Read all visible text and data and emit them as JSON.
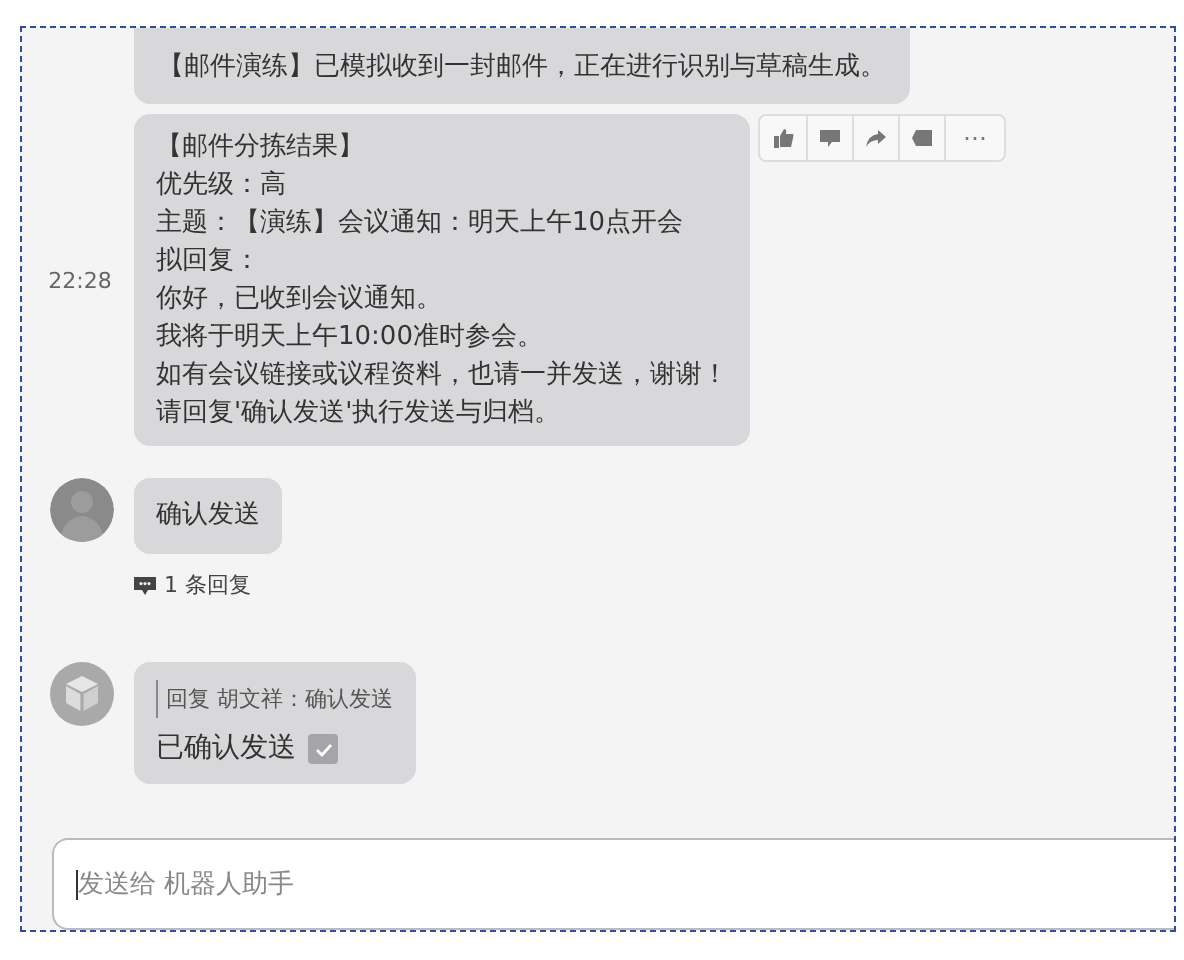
{
  "messages": [
    {
      "kind": "text",
      "lines": [
        "【邮件演练】已模拟收到一封邮件，正在进行识别与草稿生成。"
      ]
    },
    {
      "kind": "text",
      "time": "22:28",
      "lines": [
        "【邮件分拣结果】",
        "优先级：高",
        "主题：【演练】会议通知：明天上午10点开会",
        "拟回复：",
        "你好，已收到会议通知。",
        "我将于明天上午10:00准时参会。",
        "如有会议链接或议程资料，也请一并发送，谢谢！",
        "请回复'确认发送'执行发送与归档。"
      ],
      "actions": [
        {
          "kind": "like"
        },
        {
          "kind": "comment"
        },
        {
          "kind": "share"
        },
        {
          "kind": "quote"
        },
        {
          "kind": "more",
          "label": "⋯"
        }
      ]
    },
    {
      "kind": "user",
      "text": "确认发送",
      "replies": "1 条回复"
    },
    {
      "kind": "bot_reply",
      "quote": "回复 胡文祥：确认发送",
      "text": "已确认发送",
      "checked": true
    }
  ],
  "input": {
    "placeholder": "发送给 机器人助手"
  }
}
